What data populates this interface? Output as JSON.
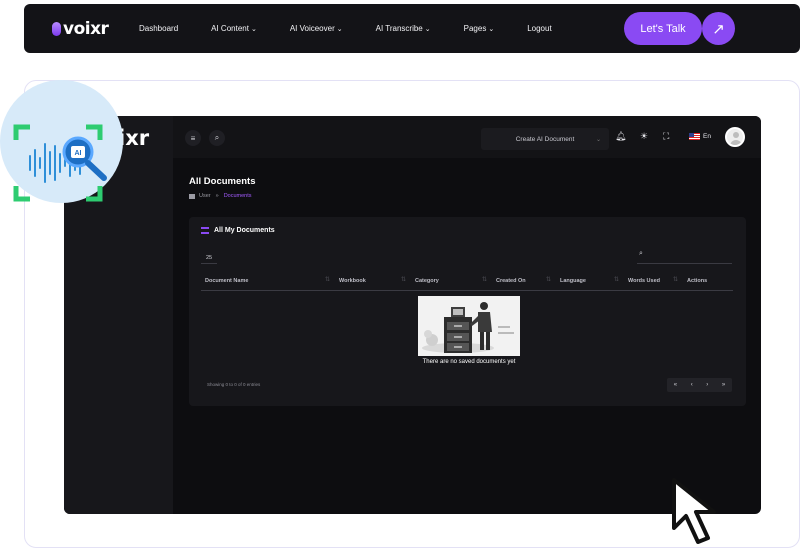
{
  "brand": {
    "logo_text": "voixr",
    "app_logo_text": "ixr"
  },
  "nav": {
    "items": [
      {
        "label": "Dashboard",
        "dropdown": false
      },
      {
        "label": "AI Content",
        "dropdown": true
      },
      {
        "label": "AI Voiceover",
        "dropdown": true
      },
      {
        "label": "AI Transcribe",
        "dropdown": true
      },
      {
        "label": "Pages",
        "dropdown": true
      },
      {
        "label": "Logout",
        "dropdown": false
      }
    ],
    "cta_label": "Let's Talk",
    "cta_arrow": "↗"
  },
  "app": {
    "header": {
      "create_document": "Create AI Document",
      "language": "En"
    },
    "sidebar_fragment": "l",
    "page_title": "All Documents",
    "breadcrumb": {
      "root": "User",
      "sep": "»",
      "current": "Documents"
    },
    "card": {
      "title": "All My Documents",
      "per_page": "25",
      "columns": [
        "Document Name",
        "Workbook",
        "Category",
        "Created On",
        "Language",
        "Words Used",
        "Actions"
      ],
      "empty_message": "There are no saved documents yet",
      "showing_text": "Showing 0 to 0 of 0 entries",
      "pager": [
        "«",
        "‹",
        "›",
        "»"
      ]
    }
  },
  "colors": {
    "accent": "#8a4af3",
    "app_bg": "#0d0d10",
    "breadcrumb_active": "#a35bff"
  }
}
